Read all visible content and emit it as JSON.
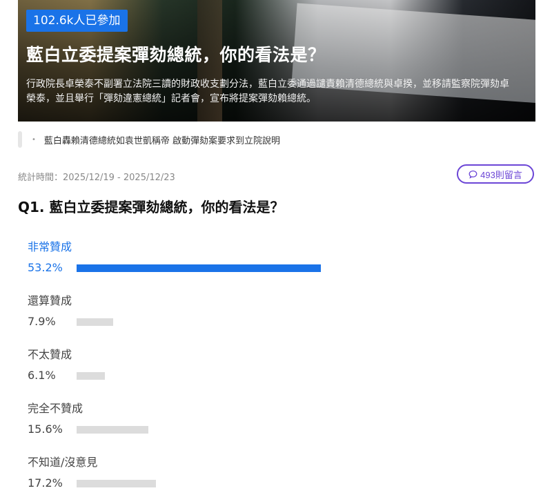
{
  "hero": {
    "participants": "102.6k人已參加",
    "title": "藍白立委提案彈劾總統，你的看法是？",
    "description": "行政院長卓榮泰不副署立法院三讀的財政收支劃分法，藍白立委通過譴責賴清德總統與卓揆，並移請監察院彈劾卓榮泰，並且舉行「彈劾違憲總統」記者會，宣布將提案彈劾賴總統。"
  },
  "related": {
    "link": "藍白轟賴清德總統如袁世凱稱帝 啟動彈劾案要求到立院說明"
  },
  "stats": {
    "period": "統計時間：2025/12/19 - 2025/12/23"
  },
  "comments": {
    "label": "493則留言",
    "icon": "comment-icon"
  },
  "question": {
    "title": "Q1. 藍白立委提案彈劾總統，你的看法是？"
  },
  "options": [
    {
      "label": "非常贊成",
      "percent": "53.2%",
      "value": 53.2,
      "top": true
    },
    {
      "label": "還算贊成",
      "percent": "7.9%",
      "value": 7.9,
      "top": false
    },
    {
      "label": "不太贊成",
      "percent": "6.1%",
      "value": 6.1,
      "top": false
    },
    {
      "label": "完全不贊成",
      "percent": "15.6%",
      "value": 15.6,
      "top": false
    },
    {
      "label": "不知道/沒意見",
      "percent": "17.2%",
      "value": 17.2,
      "top": false
    }
  ],
  "colors": {
    "accent": "#1a73e8",
    "comment_accent": "#6b45d6",
    "bar_muted": "#dcdcdc"
  }
}
